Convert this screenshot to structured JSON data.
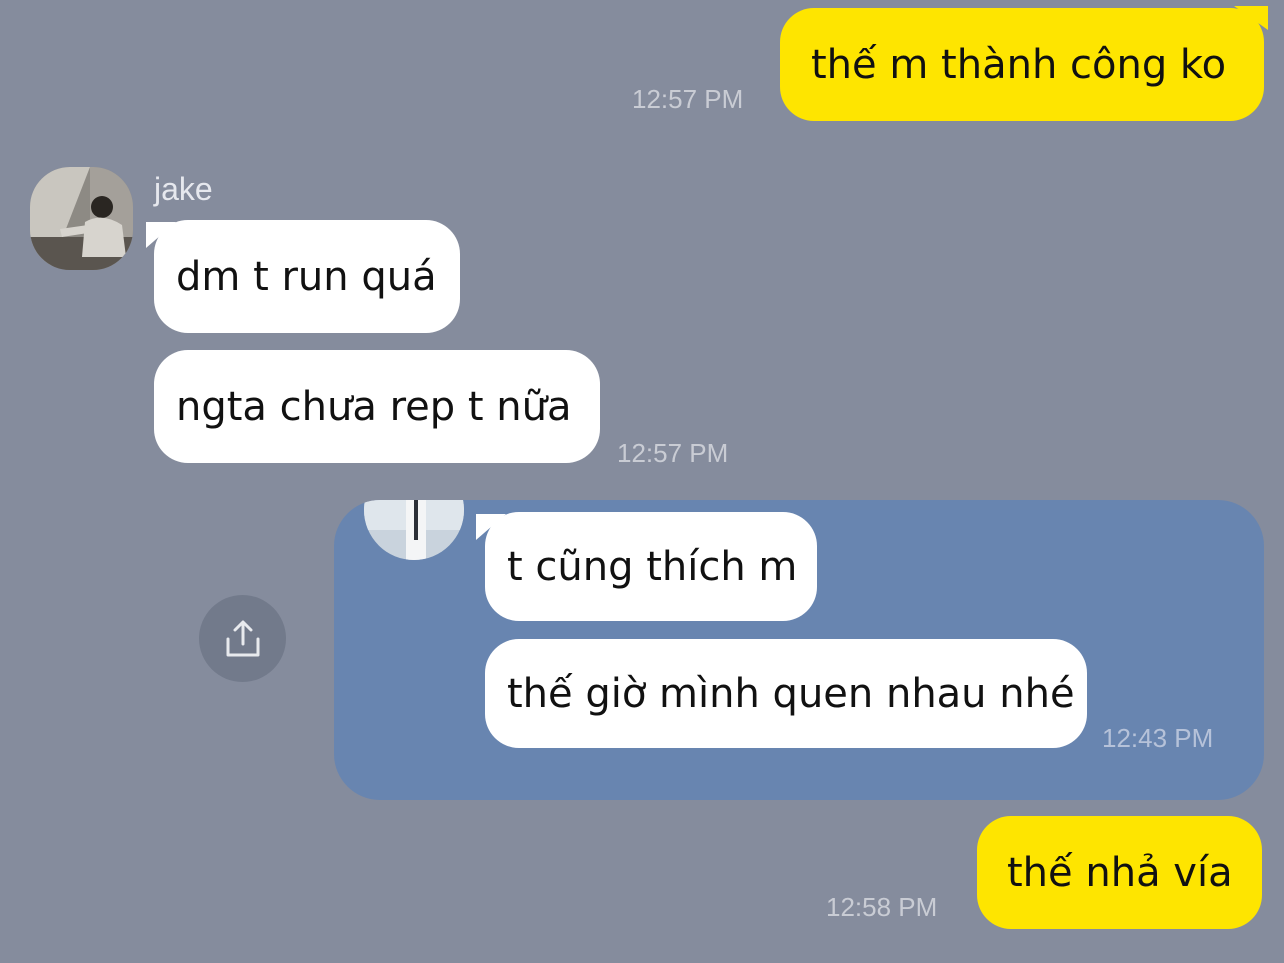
{
  "chat": {
    "messages": [
      {
        "text": "thế m thành công ko",
        "time": "12:57 PM"
      },
      {
        "sender": "jake",
        "text": "dm t run quá"
      },
      {
        "text": "ngta chưa rep t nữa",
        "time": "12:57 PM"
      },
      {
        "text": "thế nhả vía",
        "time": "12:58 PM"
      }
    ]
  },
  "shared_message": {
    "messages": [
      {
        "text": "t cũng thích m"
      },
      {
        "text": "thế giờ mình quen nhau nhé",
        "time": "12:43 PM"
      }
    ]
  },
  "icons": {
    "share": "share-icon"
  },
  "colors": {
    "background": "#858c9d",
    "sent_bubble": "#fee500",
    "received_bubble": "#ffffff",
    "shared_card": "#6885b0"
  }
}
